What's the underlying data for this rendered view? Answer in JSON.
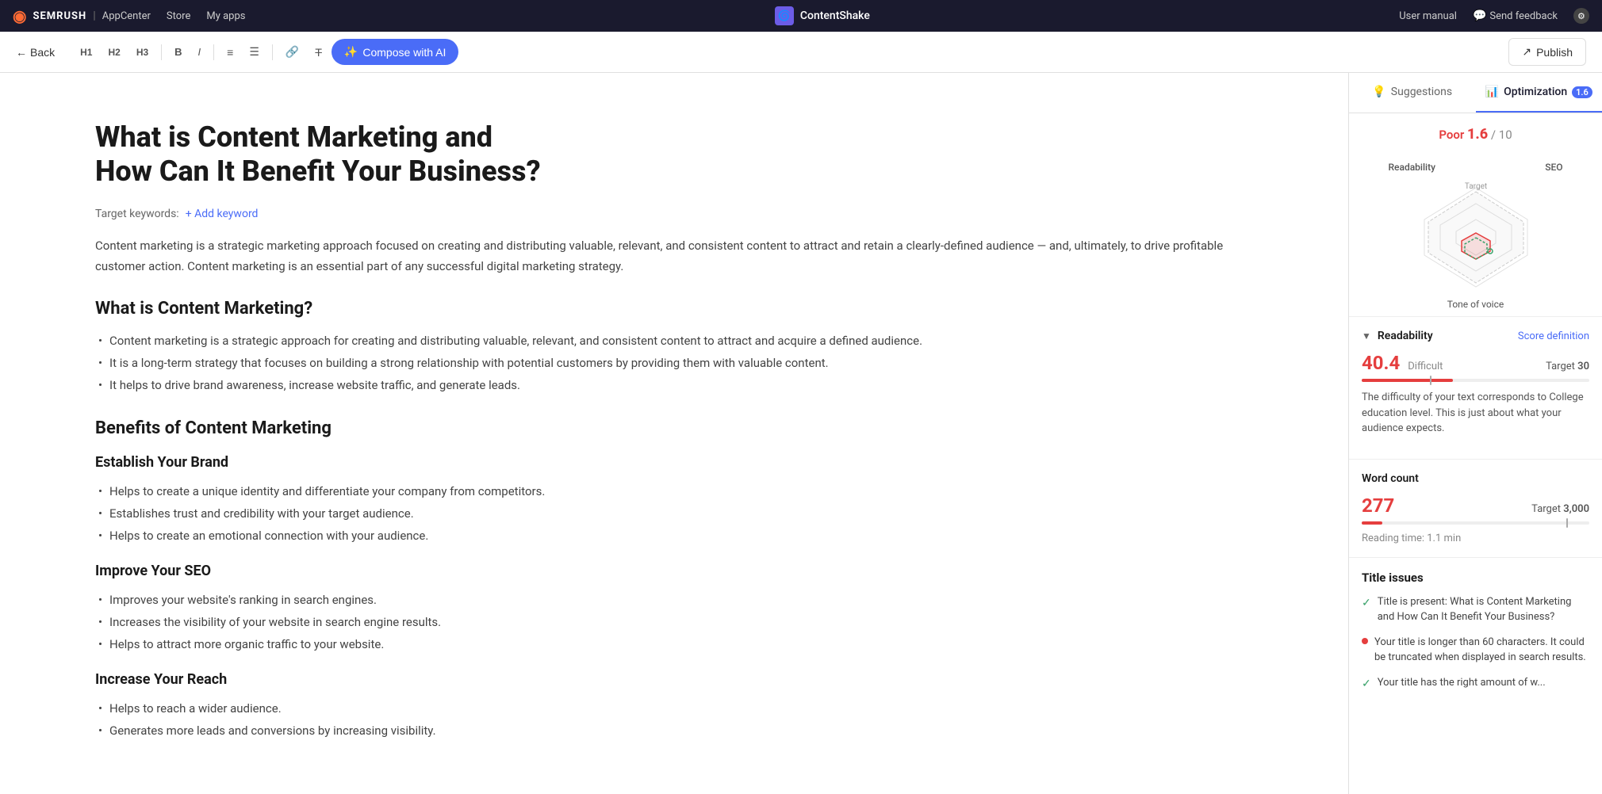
{
  "topnav": {
    "brand": "SEMRUSH",
    "separator": "|",
    "appcenter": "AppCenter",
    "store": "Store",
    "my_apps": "My apps",
    "app_icon_label": "CS",
    "app_name": "ContentShake",
    "user_manual": "User manual",
    "send_feedback": "Send feedback"
  },
  "toolbar": {
    "back_label": "Back",
    "h1": "H1",
    "h2": "H2",
    "h3": "H3",
    "bold": "B",
    "italic": "I",
    "compose_label": "Compose with AI",
    "publish_label": "Publish"
  },
  "editor": {
    "title": "What is Content Marketing and\nHow Can It Benefit Your Business?",
    "target_keywords_label": "Target keywords:",
    "add_keyword_label": "+ Add keyword",
    "intro": "Content marketing is a strategic marketing approach focused on creating and distributing valuable, relevant, and consistent content to attract and retain a clearly-defined audience — and, ultimately, to drive profitable customer action. Content marketing is an essential part of any successful digital marketing strategy.",
    "sections": [
      {
        "heading": "What is Content Marketing?",
        "type": "h2",
        "bullets": [
          "Content marketing is a strategic approach for creating and distributing valuable, relevant, and consistent content to attract and acquire a defined audience.",
          "It is a long-term strategy that focuses on building a strong relationship with potential customers by providing them with valuable content.",
          "It helps to drive brand awareness, increase website traffic, and generate leads."
        ]
      },
      {
        "heading": "Benefits of Content Marketing",
        "type": "h2",
        "bullets": []
      },
      {
        "heading": "Establish Your Brand",
        "type": "h3",
        "bullets": [
          "Helps to create a unique identity and differentiate your company from competitors.",
          "Establishes trust and credibility with your target audience.",
          "Helps to create an emotional connection with your audience."
        ]
      },
      {
        "heading": "Improve Your SEO",
        "type": "h3",
        "bullets": [
          "Improves your website's ranking in search engines.",
          "Increases the visibility of your website in search engine results.",
          "Helps to attract more organic traffic to your website."
        ]
      },
      {
        "heading": "Increase Your Reach",
        "type": "h3",
        "bullets": [
          "Helps to reach a wider audience.",
          "Generates more leads and conversions by increasing visibility."
        ]
      }
    ]
  },
  "sidebar": {
    "tabs": [
      {
        "label": "Suggestions",
        "icon": "lightbulb",
        "active": false
      },
      {
        "label": "Optimization",
        "badge": "1.6",
        "active": true
      }
    ],
    "score": {
      "quality_label": "Poor",
      "score_value": "1.6",
      "separator": "/",
      "max": "10"
    },
    "radar": {
      "label_readability": "Readability",
      "label_seo": "SEO",
      "label_tone": "Tone of voice",
      "label_target": "Target"
    },
    "readability": {
      "section_title": "Readability",
      "score_def_link": "Score definition",
      "value": "40.4",
      "level": "Difficult",
      "target_label": "Target",
      "target_value": "30",
      "description": "The difficulty of your text corresponds to College education level. This is just about what your audience expects."
    },
    "word_count": {
      "label": "Word count",
      "value": "277",
      "target_label": "Target",
      "target_value": "3,000",
      "reading_time": "Reading time: 1.1 min"
    },
    "title_issues": {
      "header": "Title issues",
      "issues": [
        {
          "type": "check",
          "text": "Title is present: What is Content Marketing and How Can It Benefit Your Business?"
        },
        {
          "type": "dot",
          "text": "Your title is longer than 60 characters. It could be truncated when displayed in search results."
        },
        {
          "type": "check",
          "text": "Your title has the right amount of w..."
        }
      ]
    }
  },
  "colors": {
    "brand_blue": "#4a6cf7",
    "danger_red": "#e53e3e",
    "success_green": "#38a169",
    "text_dark": "#1a1a1a",
    "text_muted": "#888",
    "border": "#e0e0e0",
    "nav_bg": "#1a1a2e"
  }
}
